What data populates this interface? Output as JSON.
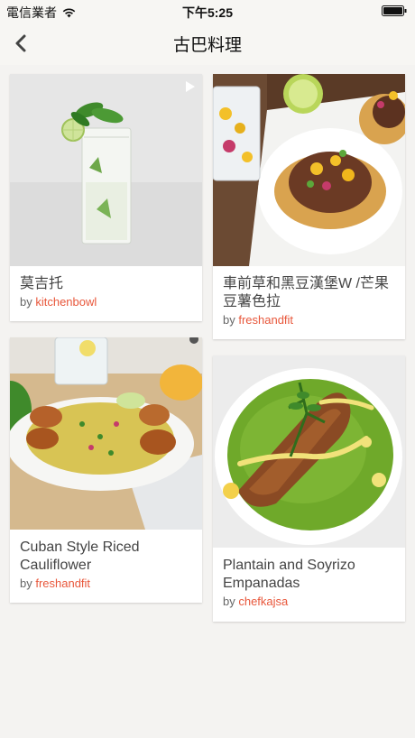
{
  "status": {
    "carrier": "電信業者",
    "time": "下午5:25"
  },
  "nav": {
    "title": "古巴料理"
  },
  "by_prefix": "by ",
  "recipes": [
    {
      "name": "莫吉托",
      "author": "kitchenbowl"
    },
    {
      "name": "車前草和黑豆漢堡W /芒果豆薯色拉",
      "author": "freshandfit"
    },
    {
      "name": "Cuban Style Riced Cauliflower",
      "author": "freshandfit"
    },
    {
      "name": "Plantain and Soyrizo Empanadas",
      "author": "chefkajsa"
    }
  ],
  "colors": {
    "author": "#e8573b",
    "background": "#f4f3f1"
  }
}
